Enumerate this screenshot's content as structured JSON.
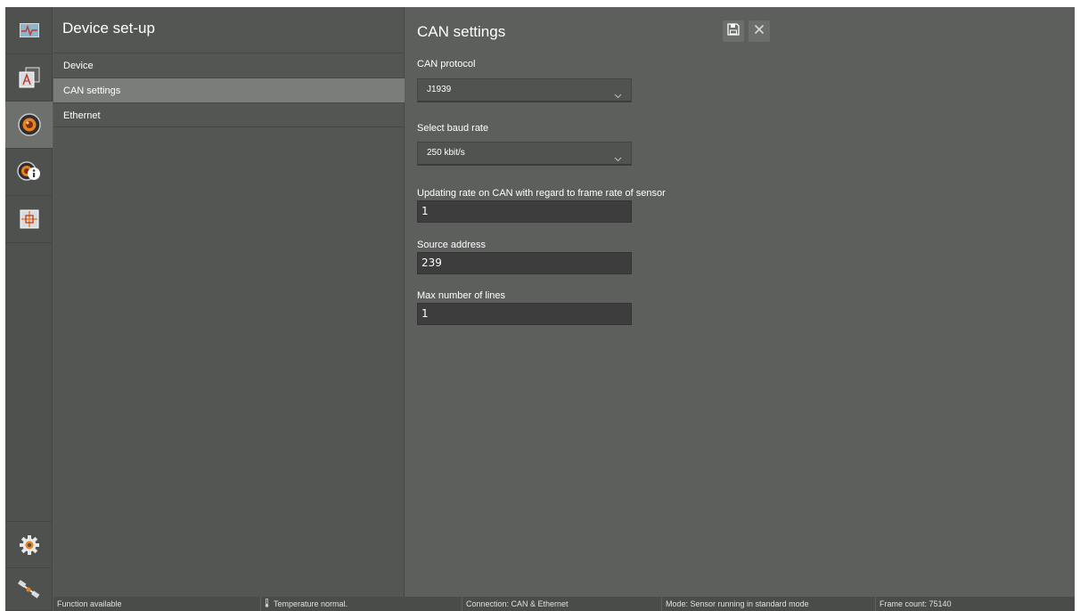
{
  "rail": {
    "items": [
      {
        "icon": "monitor-icon",
        "active": false
      },
      {
        "icon": "measurement-icon",
        "active": false
      },
      {
        "icon": "device-setup-icon",
        "active": true
      },
      {
        "icon": "device-info-icon",
        "active": false
      },
      {
        "icon": "roi-icon",
        "active": false
      },
      {
        "icon": "gear-icon",
        "active": false
      },
      {
        "icon": "satellite-icon",
        "active": false
      }
    ]
  },
  "setup": {
    "title": "Device set-up",
    "items": [
      {
        "label": "Device",
        "selected": false
      },
      {
        "label": "CAN settings",
        "selected": true
      },
      {
        "label": "Ethernet",
        "selected": false
      }
    ]
  },
  "content": {
    "title": "CAN settings",
    "save_icon": "save-icon",
    "close_icon": "close-icon",
    "protocol": {
      "label": "CAN protocol",
      "value": "J1939"
    },
    "baud": {
      "label": "Select baud rate",
      "value": "250 kbit/s"
    },
    "update_rate": {
      "label": "Updating rate on CAN with regard to frame rate of sensor",
      "value": "1"
    },
    "source_address": {
      "label": "Source address",
      "value": "239"
    },
    "max_lines": {
      "label": "Max number of lines",
      "value": "1"
    }
  },
  "status": {
    "function": "Function available",
    "temperature": "Temperature normal.",
    "connection": "Connection: CAN & Ethernet",
    "mode": "Mode: Sensor running in standard mode",
    "frame_count": "Frame count: 75140"
  },
  "colors": {
    "rail_bg": "#4f514f",
    "panel_bg": "#545654",
    "content_bg": "#5d5f5d",
    "selected_row": "#7b7d7b",
    "input_bg": "#3c3d3c",
    "accent_orange": "#e8821e"
  }
}
